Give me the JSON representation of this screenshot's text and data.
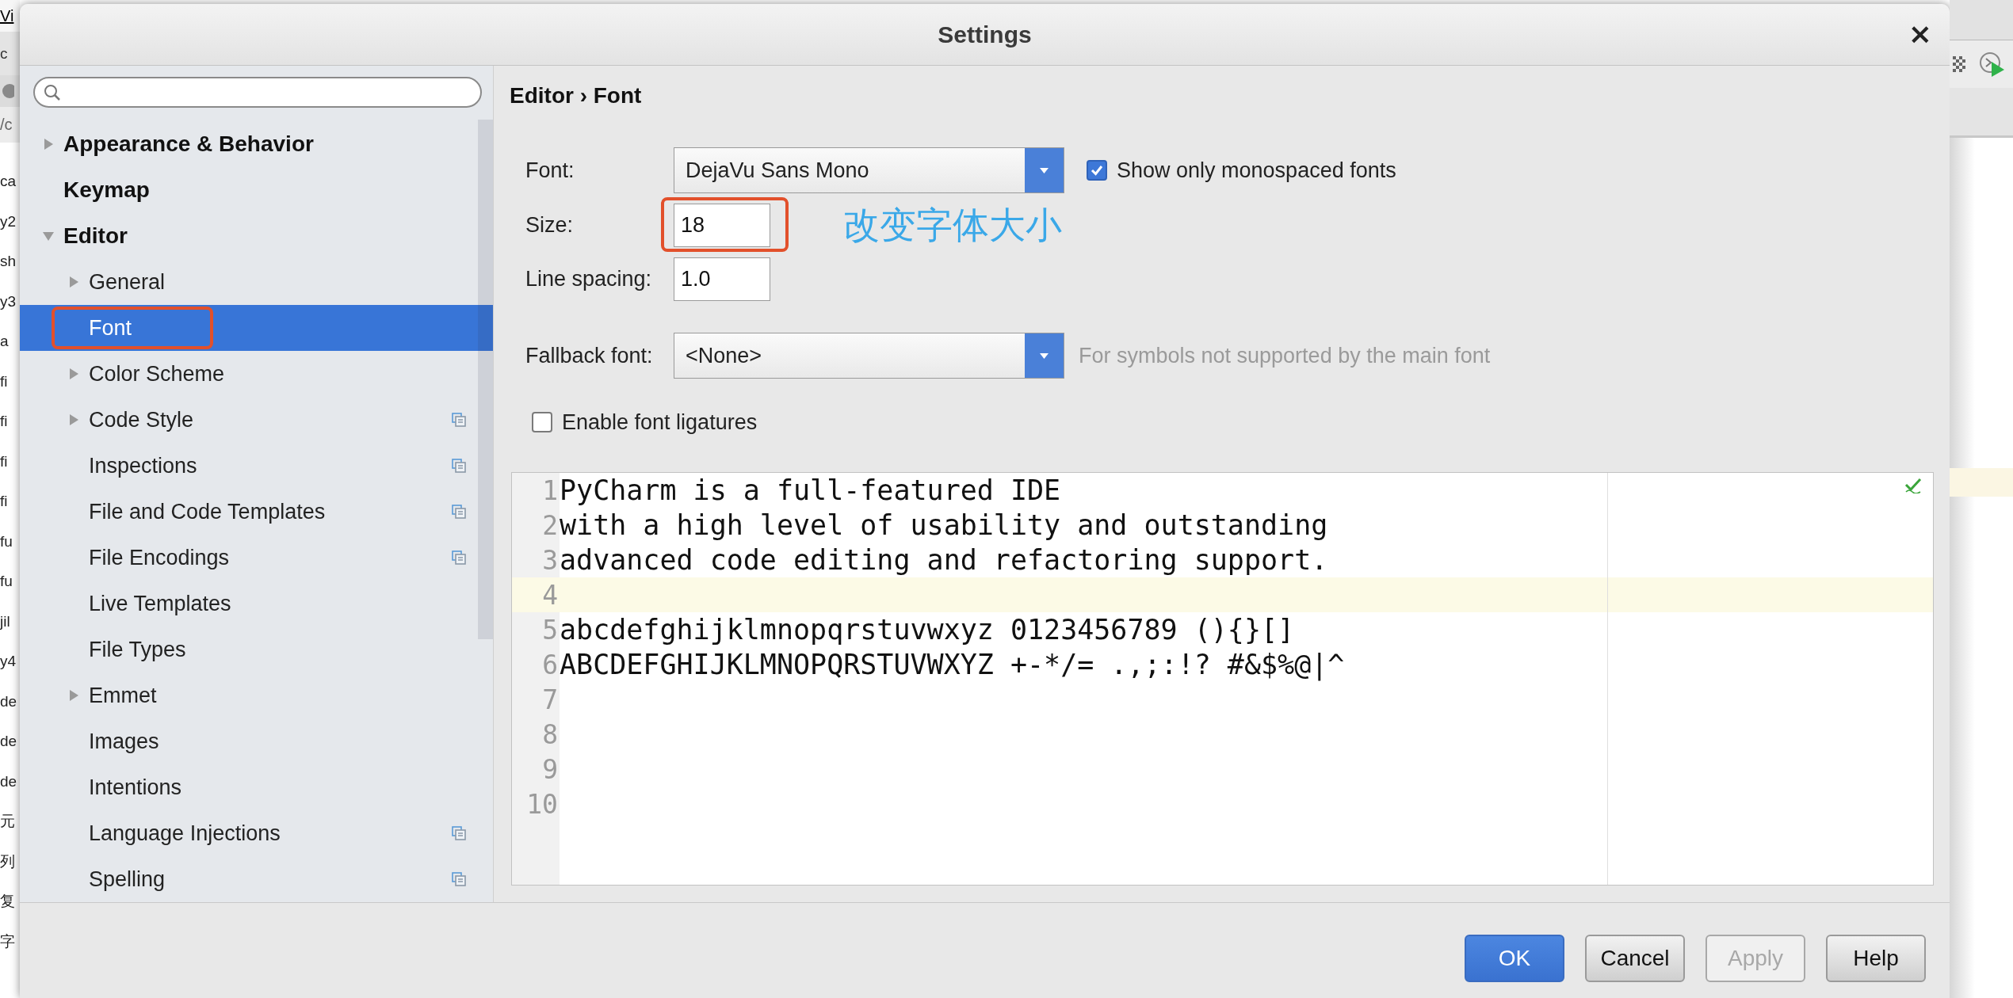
{
  "background_window": {
    "menu_fragment": "Vi",
    "toolbar_fragment": "c",
    "path_fragment": "/c",
    "file_fragments": [
      "ca",
      "y2",
      "sh",
      "y3",
      "a",
      "fi",
      "fi",
      "fi",
      "fi",
      "fu",
      "fu",
      "jil",
      "y4",
      "de",
      "de",
      "de",
      "元",
      "列",
      "复",
      "字"
    ]
  },
  "window": {
    "title": "Settings",
    "close": "×"
  },
  "sidebar": {
    "items": [
      {
        "label": "Appearance & Behavior",
        "expandable": true,
        "expanded": false,
        "selected": false,
        "highlighted": false,
        "project_icon": false
      },
      {
        "label": "Keymap",
        "expandable": false,
        "selected": false,
        "highlighted": false,
        "project_icon": false
      },
      {
        "label": "Editor",
        "expandable": true,
        "expanded": true,
        "selected": false,
        "highlighted": false,
        "project_icon": false,
        "children": [
          {
            "label": "General",
            "expandable": true,
            "expanded": false,
            "selected": false,
            "highlighted": false,
            "project_icon": false
          },
          {
            "label": "Font",
            "expandable": false,
            "selected": true,
            "highlighted": true,
            "project_icon": false
          },
          {
            "label": "Color Scheme",
            "expandable": true,
            "expanded": false,
            "selected": false,
            "highlighted": false,
            "project_icon": false
          },
          {
            "label": "Code Style",
            "expandable": true,
            "expanded": false,
            "selected": false,
            "highlighted": false,
            "project_icon": true
          },
          {
            "label": "Inspections",
            "expandable": false,
            "selected": false,
            "highlighted": false,
            "project_icon": true
          },
          {
            "label": "File and Code Templates",
            "expandable": false,
            "selected": false,
            "highlighted": false,
            "project_icon": true
          },
          {
            "label": "File Encodings",
            "expandable": false,
            "selected": false,
            "highlighted": false,
            "project_icon": true
          },
          {
            "label": "Live Templates",
            "expandable": false,
            "selected": false,
            "highlighted": false,
            "project_icon": false
          },
          {
            "label": "File Types",
            "expandable": false,
            "selected": false,
            "highlighted": false,
            "project_icon": false
          },
          {
            "label": "Emmet",
            "expandable": true,
            "expanded": false,
            "selected": false,
            "highlighted": false,
            "project_icon": false
          },
          {
            "label": "Images",
            "expandable": false,
            "selected": false,
            "highlighted": false,
            "project_icon": false
          },
          {
            "label": "Intentions",
            "expandable": false,
            "selected": false,
            "highlighted": false,
            "project_icon": false
          },
          {
            "label": "Language Injections",
            "expandable": false,
            "selected": false,
            "highlighted": false,
            "project_icon": true
          },
          {
            "label": "Spelling",
            "expandable": false,
            "selected": false,
            "highlighted": false,
            "project_icon": true
          }
        ]
      }
    ]
  },
  "breadcrumb": "Editor › Font",
  "font_settings": {
    "font": {
      "label": "Font:",
      "value": "DejaVu Sans Mono"
    },
    "monospaced": {
      "label": "Show only monospaced fonts",
      "checked": true
    },
    "size": {
      "label": "Size:",
      "value": "18",
      "highlighted": true
    },
    "line_spacing": {
      "label": "Line spacing:",
      "value": "1.0"
    },
    "fallback": {
      "label": "Fallback font:",
      "value": "<None>",
      "hint": "For symbols not supported by the main font"
    },
    "ligatures": {
      "label": "Enable font ligatures",
      "checked": false
    }
  },
  "annotation": {
    "text": "改变字体大小"
  },
  "preview": {
    "lines": [
      {
        "number": "1",
        "text": "PyCharm is a full-featured IDE",
        "current": false
      },
      {
        "number": "2",
        "text": "with a high level of usability and outstanding",
        "current": false
      },
      {
        "number": "3",
        "text": "advanced code editing and refactoring support.",
        "current": false
      },
      {
        "number": "4",
        "current": true
      },
      {
        "number": "5",
        "text": "abcdefghijklmnopqrstuvwxyz 0123456789 (){}[]",
        "current": false
      },
      {
        "number": "6",
        "text": "ABCDEFGHIJKLMNOPQRSTUVWXYZ +-*/= .,;:!? #&$%@|^",
        "current": false
      },
      {
        "number": "7",
        "current": false
      },
      {
        "number": "8",
        "current": false
      },
      {
        "number": "9",
        "current": false
      },
      {
        "number": "10",
        "current": false
      }
    ]
  },
  "buttons": [
    {
      "label": "OK",
      "kind": "default",
      "disabled": false
    },
    {
      "label": "Cancel",
      "kind": "normal",
      "disabled": false
    },
    {
      "label": "Apply",
      "kind": "normal",
      "disabled": true
    },
    {
      "label": "Help",
      "kind": "normal",
      "disabled": false
    }
  ]
}
